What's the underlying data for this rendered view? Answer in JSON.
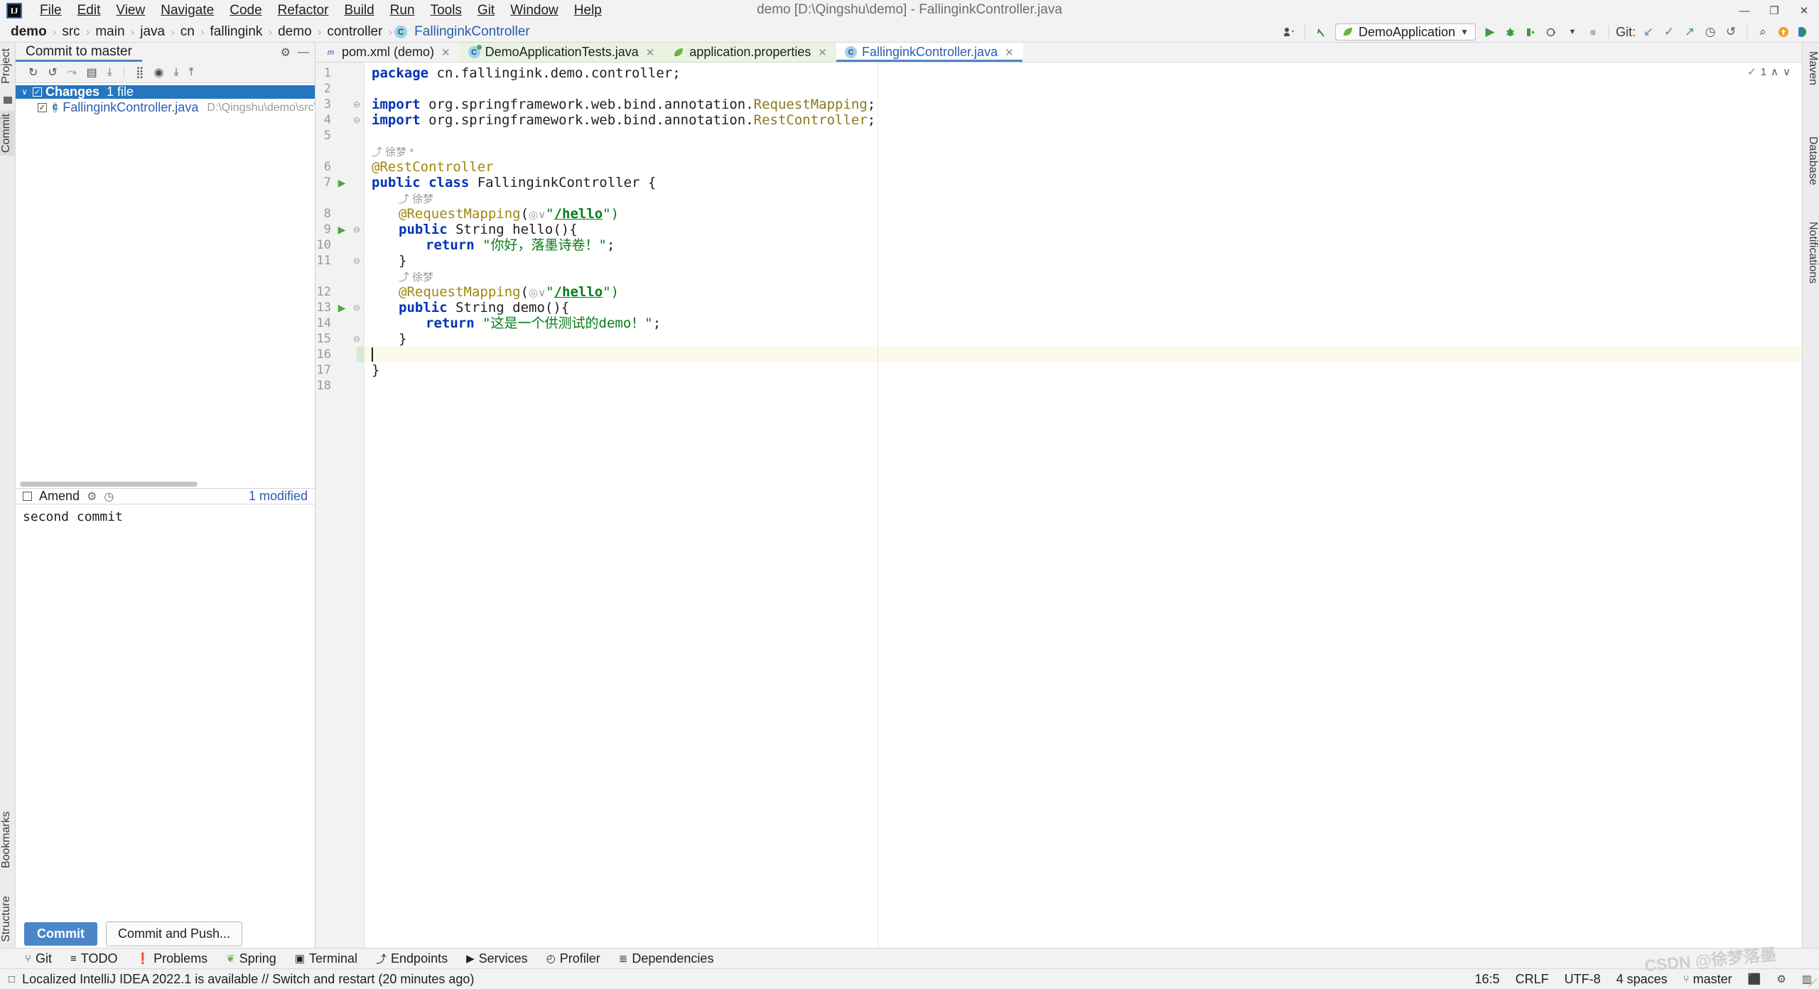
{
  "titlebar": {
    "logo": "IJ",
    "window_title": "demo [D:\\Qingshu\\demo] - FallinginkController.java",
    "menu": [
      "File",
      "Edit",
      "View",
      "Navigate",
      "Code",
      "Refactor",
      "Build",
      "Run",
      "Tools",
      "Git",
      "Window",
      "Help"
    ],
    "minimize": "—",
    "maximize": "❐",
    "close": "✕"
  },
  "navbar": {
    "crumbs": [
      "demo",
      "src",
      "main",
      "java",
      "cn",
      "fallingink",
      "demo",
      "controller",
      "FallinginkController"
    ],
    "separator": "›",
    "class_badge": "C",
    "run_config": "DemoApplication",
    "git_label": "Git:",
    "icons": {
      "profile": "profile-icon",
      "back_arrow": "↖",
      "run": "▶",
      "debug": "⚙",
      "coverage": "↪",
      "profile_run": "◴",
      "stop": "■",
      "update": "↙",
      "commit": "✓",
      "push": "↗",
      "history": "◷",
      "rollback": "↶",
      "search": "⌕",
      "updates": "↑",
      "ide": "◗"
    }
  },
  "left_strip": {
    "items": [
      "Project",
      "Commit",
      "Bookmarks",
      "Structure"
    ]
  },
  "right_strip": {
    "items": [
      "Maven",
      "Database",
      "Notifications"
    ]
  },
  "commit_panel": {
    "title": "Commit to master",
    "settings_icon": "⚙",
    "minimize_icon": "—",
    "toolbar_icons": [
      "refresh-icon",
      "rollback-icon",
      "shelve-icon",
      "diff-icon",
      "download-icon",
      "group-icon",
      "preview-icon",
      "expand-all-icon",
      "collapse-all-icon"
    ],
    "tree": {
      "root_label": "Changes",
      "root_count": "1 file",
      "file_name": "FallinginkController.java",
      "file_path": "D:\\Qingshu\\demo\\src\\main\\java\\c",
      "file_badge": "C",
      "chevron": "∨",
      "check": "✓"
    },
    "amend_label": "Amend",
    "amend_checked": false,
    "gear_icon": "⚙",
    "history_icon": "◷",
    "modified_text": "1 modified",
    "commit_message": "second commit",
    "commit_button": "Commit",
    "commit_push_button": "Commit and Push..."
  },
  "editor": {
    "tabs": [
      {
        "label": "pom.xml (demo)",
        "icon": "maven-icon",
        "icon_char": "m",
        "state": "normal"
      },
      {
        "label": "DemoApplicationTests.java",
        "icon": "class-test-icon",
        "icon_char": "C",
        "state": "green"
      },
      {
        "label": "application.properties",
        "icon": "spring-properties-icon",
        "icon_char": "❦",
        "state": "normal"
      },
      {
        "label": "FallinginkController.java",
        "icon": "class-icon",
        "icon_char": "C",
        "state": "active"
      }
    ],
    "tab_close": "✕",
    "inspection": {
      "warn_count": "1",
      "up": "∧",
      "down": "∨",
      "ok": "✓"
    },
    "lines": [
      {
        "num": "1",
        "segments": [
          {
            "t": "package ",
            "c": "kw"
          },
          {
            "t": "cn.fallingink.demo.controller;",
            "c": "plain"
          }
        ],
        "indent": 0
      },
      {
        "num": "2",
        "segments": [],
        "indent": 0
      },
      {
        "num": "3",
        "segments": [
          {
            "t": "import ",
            "c": "kw"
          },
          {
            "t": "org.springframework.web.bind.annotation.",
            "c": "plain"
          },
          {
            "t": "RequestMapping",
            "c": "cls-ref"
          },
          {
            "t": ";",
            "c": "plain"
          }
        ],
        "indent": 0,
        "fold": "⊖"
      },
      {
        "num": "4",
        "segments": [
          {
            "t": "import ",
            "c": "kw"
          },
          {
            "t": "org.springframework.web.bind.annotation.",
            "c": "plain"
          },
          {
            "t": "RestController",
            "c": "cls-ref"
          },
          {
            "t": ";",
            "c": "plain"
          }
        ],
        "indent": 0,
        "fold": "⊖"
      },
      {
        "num": "5",
        "segments": [],
        "indent": 0
      },
      {
        "num": "",
        "segments": [
          {
            "t": "⤴ 徐梦 *",
            "c": "hint"
          }
        ],
        "indent": 0,
        "is_hint": true
      },
      {
        "num": "6",
        "segments": [
          {
            "t": "@RestController",
            "c": "anno"
          }
        ],
        "indent": 0
      },
      {
        "num": "7",
        "segments": [
          {
            "t": "public class ",
            "c": "kw"
          },
          {
            "t": "FallinginkController",
            "c": "plain"
          },
          {
            "t": " {",
            "c": "plain"
          }
        ],
        "indent": 0,
        "run": true
      },
      {
        "num": "",
        "segments": [
          {
            "t": "⤴ 徐梦",
            "c": "hint"
          }
        ],
        "indent": 1,
        "is_hint": true
      },
      {
        "num": "8",
        "segments": [
          {
            "t": "@RequestMapping",
            "c": "anno"
          },
          {
            "t": "(",
            "c": "plain"
          },
          {
            "t": "◎∨",
            "c": "hint"
          },
          {
            "t": "\"",
            "c": "str"
          },
          {
            "t": "/hello",
            "c": "lnk"
          },
          {
            "t": "\")",
            "c": "str"
          }
        ],
        "indent": 1
      },
      {
        "num": "9",
        "segments": [
          {
            "t": "public ",
            "c": "kw"
          },
          {
            "t": "String hello(){",
            "c": "plain"
          }
        ],
        "indent": 1,
        "run": true,
        "fold": "⊖"
      },
      {
        "num": "10",
        "segments": [
          {
            "t": "return ",
            "c": "kw"
          },
          {
            "t": "\"你好，落墨诗卷！\"",
            "c": "str"
          },
          {
            "t": ";",
            "c": "plain"
          }
        ],
        "indent": 2
      },
      {
        "num": "11",
        "segments": [
          {
            "t": "}",
            "c": "plain"
          }
        ],
        "indent": 1,
        "fold": "⊖"
      },
      {
        "num": "",
        "segments": [
          {
            "t": "⤴ 徐梦",
            "c": "hint"
          }
        ],
        "indent": 1,
        "is_hint": true
      },
      {
        "num": "12",
        "segments": [
          {
            "t": "@RequestMapping",
            "c": "anno"
          },
          {
            "t": "(",
            "c": "plain"
          },
          {
            "t": "◎∨",
            "c": "hint"
          },
          {
            "t": "\"",
            "c": "str"
          },
          {
            "t": "/hello",
            "c": "lnk"
          },
          {
            "t": "\")",
            "c": "str"
          }
        ],
        "indent": 1
      },
      {
        "num": "13",
        "segments": [
          {
            "t": "public ",
            "c": "kw"
          },
          {
            "t": "String demo(){",
            "c": "plain"
          }
        ],
        "indent": 1,
        "run": true,
        "fold": "⊖"
      },
      {
        "num": "14",
        "segments": [
          {
            "t": "return ",
            "c": "kw"
          },
          {
            "t": "\"这是一个供测试的demo！\"",
            "c": "str"
          },
          {
            "t": ";",
            "c": "plain"
          }
        ],
        "indent": 2
      },
      {
        "num": "15",
        "segments": [
          {
            "t": "}",
            "c": "plain"
          }
        ],
        "indent": 1,
        "fold": "⊖"
      },
      {
        "num": "16",
        "segments": [],
        "indent": 0,
        "current": true
      },
      {
        "num": "17",
        "segments": [
          {
            "t": "}",
            "c": "plain"
          }
        ],
        "indent": 0
      },
      {
        "num": "18",
        "segments": [],
        "indent": 0
      }
    ]
  },
  "bottom_tools": [
    {
      "label": "Git",
      "icon": "⑂"
    },
    {
      "label": "TODO",
      "icon": "≡"
    },
    {
      "label": "Problems",
      "icon": "❗"
    },
    {
      "label": "Spring",
      "icon": "❦"
    },
    {
      "label": "Terminal",
      "icon": "▣"
    },
    {
      "label": "Endpoints",
      "icon": "⤴"
    },
    {
      "label": "Services",
      "icon": "▶"
    },
    {
      "label": "Profiler",
      "icon": "◴"
    },
    {
      "label": "Dependencies",
      "icon": "≣"
    }
  ],
  "status_bar": {
    "notify_icon": "□",
    "message": "Localized IntelliJ IDEA 2022.1 is available // Switch and restart (20 minutes ago)",
    "caret": "16:5",
    "line_sep": "CRLF",
    "encoding": "UTF-8",
    "indent": "4 spaces",
    "branch": "master",
    "branch_icon": "⑂",
    "lock_icon": "⬛",
    "inspect_icon": "⚙",
    "mem_icon": "▥"
  },
  "watermark": "CSDN @徐梦落墨"
}
